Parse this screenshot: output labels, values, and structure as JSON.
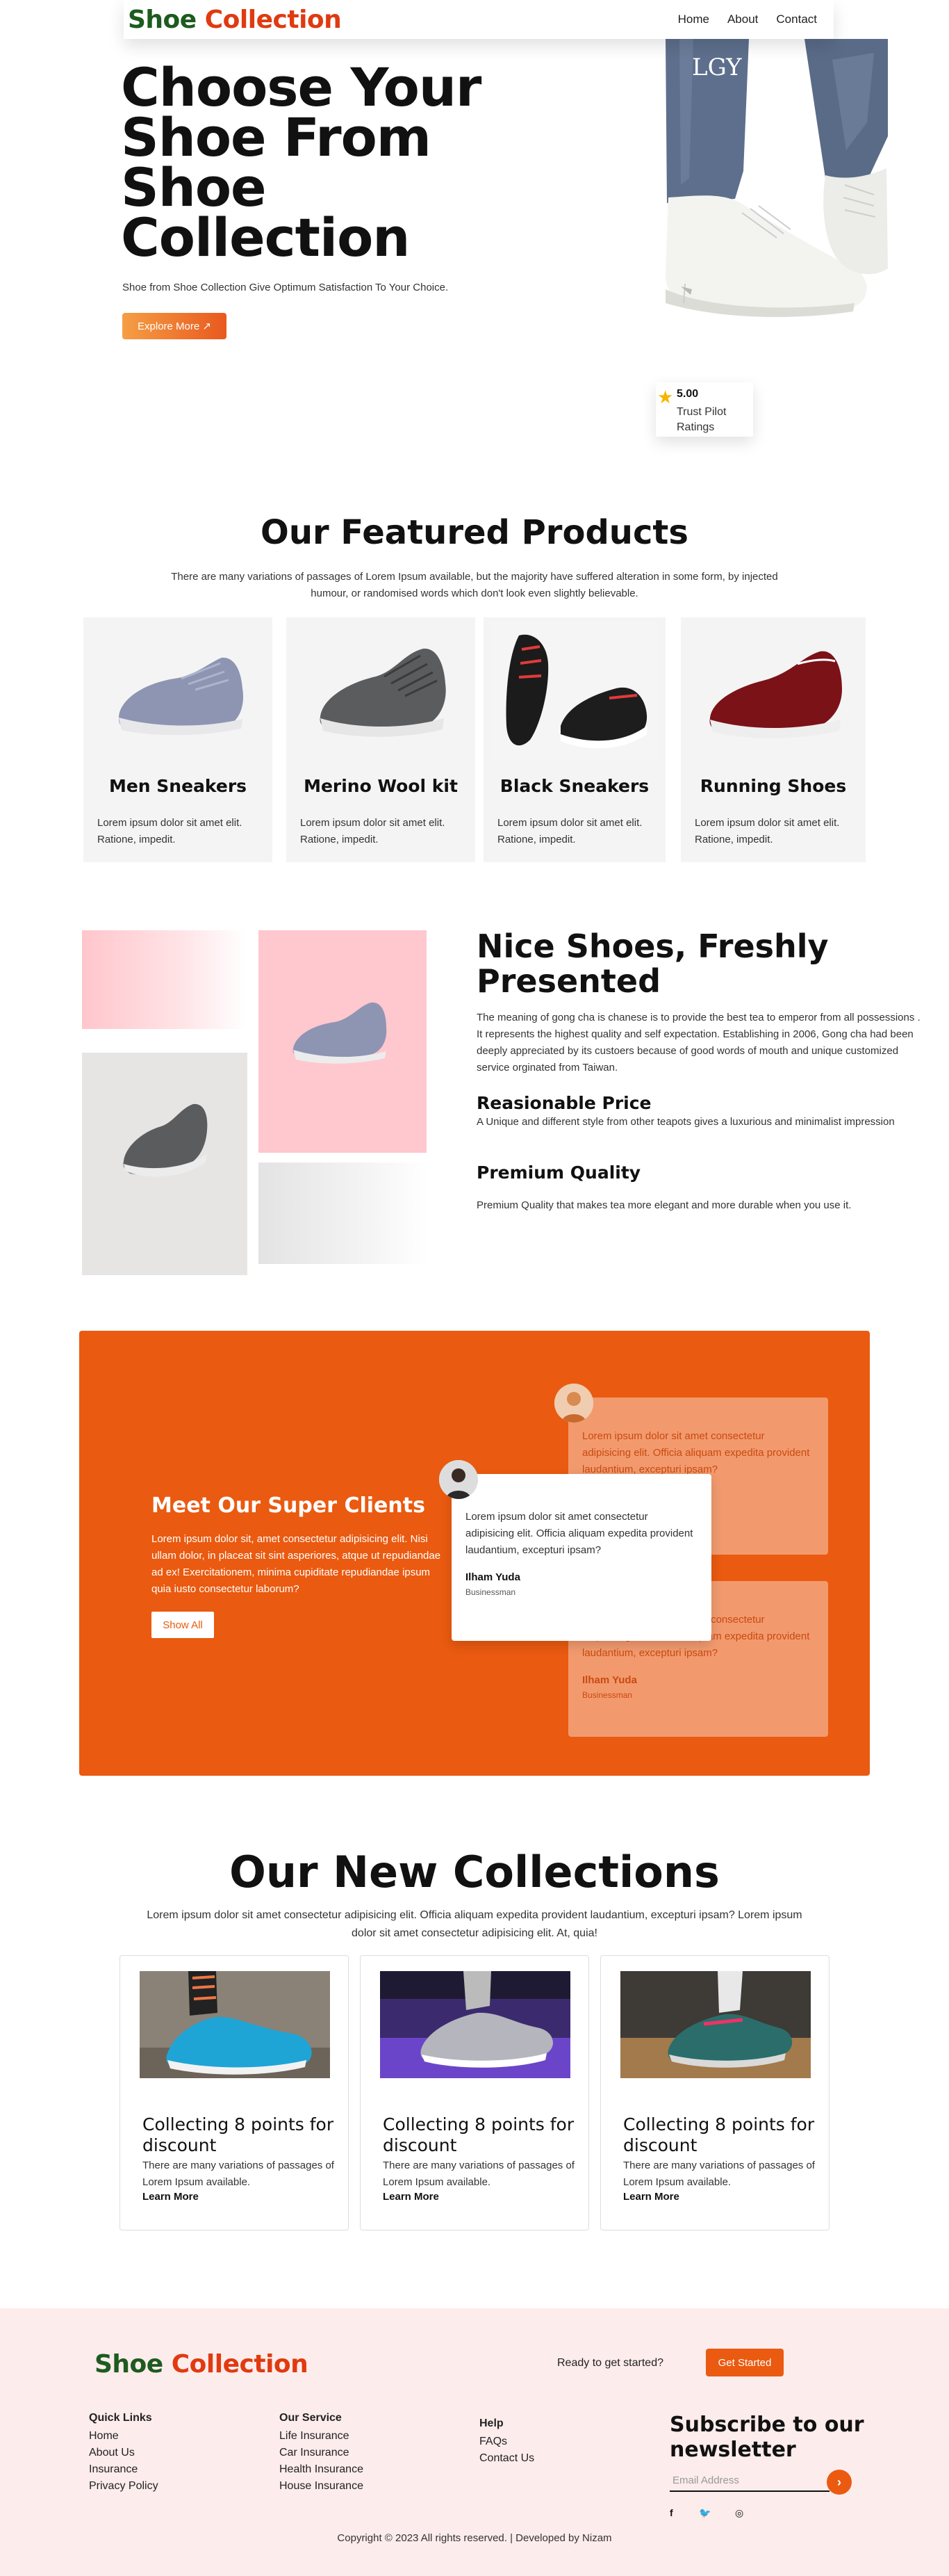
{
  "brand": {
    "word1": "Shoe",
    "word2": "Collection"
  },
  "nav": {
    "items": [
      "Home",
      "About",
      "Contact"
    ]
  },
  "hero": {
    "title": "Choose Your Shoe From Shoe Collection",
    "subtitle": "Shoe from Shoe Collection Give Optimum Satisfaction To Your Choice.",
    "button": "Explore More ↗",
    "rating_value": "5.00",
    "rating_label": "Trust Pilot Ratings"
  },
  "featured": {
    "title": "Our Featured Products",
    "description": "There are many variations of passages of Lorem Ipsum available, but the majority have suffered alteration in some form, by injected humour, or randomised words which don't look even slightly believable.",
    "products": [
      {
        "name": "Men Sneakers",
        "desc": "Lorem ipsum dolor sit amet elit. Ratione, impedit."
      },
      {
        "name": "Merino Wool kit",
        "desc": "Lorem ipsum dolor sit amet elit. Ratione, impedit."
      },
      {
        "name": "Black Sneakers",
        "desc": "Lorem ipsum dolor sit amet elit. Ratione, impedit."
      },
      {
        "name": "Running Shoes",
        "desc": "Lorem ipsum dolor sit amet elit. Ratione, impedit."
      }
    ]
  },
  "nice": {
    "title": "Nice Shoes, Freshly Presented",
    "paragraph": "The meaning of gong cha is chanese is to provide the best tea to emperor from all possessions . It represents the highest quality and self expectation. Establishing in 2006, Gong cha had been deeply appreciated by its custoers because of good words of mouth and unique customized service orginated from Taiwan.",
    "feature1_title": "Reasionable Price",
    "feature1_desc": "A Unique and different style from other teapots gives a luxurious and minimalist impression",
    "feature2_title": "Premium Quality",
    "feature2_desc": "Premium Quality that makes tea more elegant and more durable when you use it."
  },
  "clients": {
    "title": "Meet Our Super Clients",
    "description": "Lorem ipsum dolor sit, amet consectetur adipisicing elit. Nisi ullam dolor, in placeat sit sint asperiores, atque ut repudiandae ad ex! Exercitationem, minima cupiditate repudiandae ipsum quia iusto consectetur laborum?",
    "button": "Show All",
    "testimonials": [
      {
        "quote": "Lorem ipsum dolor sit amet consectetur adipisicing elit. Officia aliquam expedita provident laudantium, excepturi ipsam?",
        "name": "Ilham Yuda",
        "role": "Businessman"
      },
      {
        "quote": "Lorem ipsum dolor sit amet consectetur adipisicing elit. Officia aliquam expedita provident laudantium, excepturi ipsam?",
        "name": "Ilham Yuda",
        "role": "Businessman"
      },
      {
        "quote": "Lorem ipsum dolor sit amet consectetur adipisicing elit. Officia aliquam expedita provident laudantium, excepturi ipsam?",
        "name": "Ilham Yuda",
        "role": "Businessman"
      }
    ]
  },
  "collections": {
    "title": "Our New Collections",
    "description": "Lorem ipsum dolor sit amet consectetur adipisicing elit. Officia aliquam expedita provident laudantium, excepturi ipsam? Lorem ipsum dolor sit amet consectetur adipisicing elit. At, quia!",
    "cards": [
      {
        "title": "Collecting 8 points for discount",
        "desc": "There are many variations of passages of Lorem Ipsum available.",
        "link": "Learn More"
      },
      {
        "title": "Collecting 8 points for discount",
        "desc": "There are many variations of passages of Lorem Ipsum available.",
        "link": "Learn More"
      },
      {
        "title": "Collecting 8 points for discount",
        "desc": "There are many variations of passages of Lorem Ipsum available.",
        "link": "Learn More"
      }
    ]
  },
  "footer": {
    "ready": "Ready to get started?",
    "get_started": "Get Started",
    "quick_links": {
      "title": "Quick Links",
      "items": [
        "Home",
        "About Us",
        "Insurance",
        "Privacy Policy"
      ]
    },
    "service": {
      "title": "Our Service",
      "items": [
        "Life Insurance",
        "Car Insurance",
        "Health Insurance",
        "House Insurance"
      ]
    },
    "help": {
      "title": "Help",
      "items": [
        "FAQs",
        "Contact Us"
      ]
    },
    "newsletter_title": "Subscribe to our newsletter",
    "email_placeholder": "Email Address",
    "social": [
      "f",
      "🐦",
      "◎"
    ],
    "copyright": "Copyright © 2023 All rights reserved. | Developed by Nizam"
  },
  "colors": {
    "brand_green": "#1d5b1f",
    "brand_orange": "#e03a10",
    "accent": "#ea5a10",
    "footer_bg": "#fdecec",
    "pink_tile": "#ffc7ce"
  }
}
